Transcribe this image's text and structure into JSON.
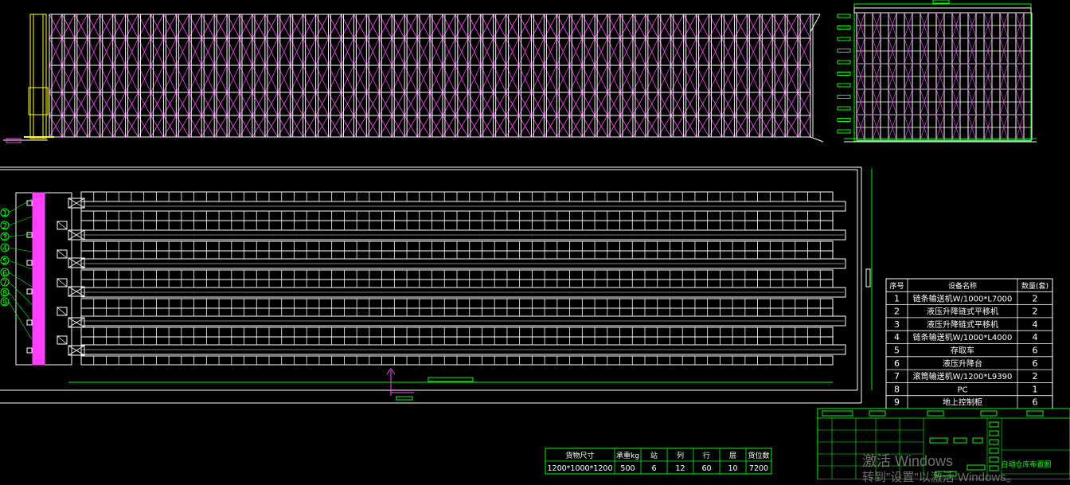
{
  "colors": {
    "background": "#000000",
    "rack": "#ffffff",
    "brace": "#ff40ff",
    "frame": "#00ff00",
    "crane": "#ffff00"
  },
  "parts_table": {
    "headers": [
      "序号",
      "设备名称",
      "数量(套)"
    ],
    "rows": [
      {
        "no": "1",
        "name": "链条输送机W/1000*L7000",
        "qty": "2"
      },
      {
        "no": "2",
        "name": "液压升降链式平移机",
        "qty": "2"
      },
      {
        "no": "3",
        "name": "液压升降链式平移机",
        "qty": "4"
      },
      {
        "no": "4",
        "name": "链条输送机W/1000*L4000",
        "qty": "4"
      },
      {
        "no": "5",
        "name": "存取车",
        "qty": "6"
      },
      {
        "no": "6",
        "name": "液压升降台",
        "qty": "6"
      },
      {
        "no": "7",
        "name": "滚筒输送机W/1200*L9390",
        "qty": "2"
      },
      {
        "no": "8",
        "name": "PC",
        "qty": "1"
      },
      {
        "no": "9",
        "name": "地上控制柜",
        "qty": "6"
      }
    ]
  },
  "spec_table": {
    "headers": [
      "货物尺寸",
      "承重kg",
      "站",
      "列",
      "行",
      "层",
      "货位数"
    ],
    "values": [
      "1200*1000*1200",
      "500",
      "6",
      "12",
      "60",
      "10",
      "7200"
    ]
  },
  "title_block": {
    "drawing_name": "自动仓库布置图"
  },
  "callouts": [
    "1",
    "2",
    "3",
    "4",
    "5",
    "6",
    "7",
    "8",
    "9"
  ],
  "watermark": {
    "line1": "激活 Windows",
    "line2": "转到\"设置\"以激活 Windows。"
  }
}
